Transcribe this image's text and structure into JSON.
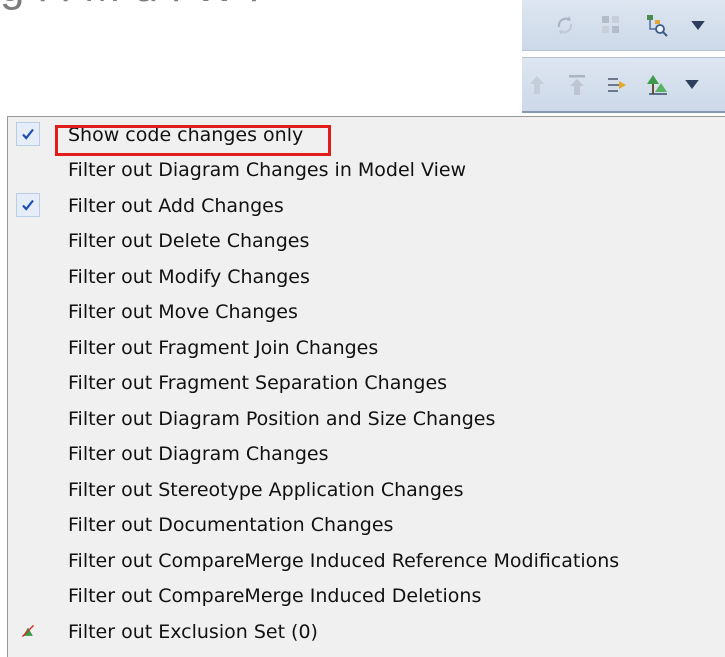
{
  "page": {
    "heading_text": "g   l   l    M   d   l  W   l"
  },
  "toolbar": {
    "top_row": [
      {
        "icon": "sync-arrows-icon"
      },
      {
        "icon": "grid-layout-icon"
      },
      {
        "icon": "tree-search-icon"
      },
      {
        "icon": "dropdown-arrow-icon"
      }
    ],
    "bottom_row": [
      {
        "icon": "up-arrow-icon"
      },
      {
        "icon": "up-top-arrow-icon"
      },
      {
        "icon": "merge-right-icon"
      },
      {
        "icon": "tree-filter-icon"
      },
      {
        "icon": "dropdown-arrow-icon"
      }
    ]
  },
  "menu": {
    "items": [
      {
        "label": "Show code changes only",
        "checked": true
      },
      {
        "label": "Filter out Diagram Changes in Model View",
        "checked": false
      },
      {
        "label": "Filter out Add Changes",
        "checked": true
      },
      {
        "label": "Filter out Delete Changes",
        "checked": false
      },
      {
        "label": "Filter out Modify Changes",
        "checked": false
      },
      {
        "label": "Filter out Move Changes",
        "checked": false
      },
      {
        "label": "Filter out Fragment Join Changes",
        "checked": false
      },
      {
        "label": "Filter out Fragment Separation Changes",
        "checked": false
      },
      {
        "label": "Filter out Diagram Position and Size Changes",
        "checked": false
      },
      {
        "label": "Filter out Diagram Changes",
        "checked": false
      },
      {
        "label": "Filter out Stereotype Application Changes",
        "checked": false
      },
      {
        "label": "Filter out Documentation Changes",
        "checked": false
      },
      {
        "label": "Filter out CompareMerge Induced Reference Modifications",
        "checked": false
      },
      {
        "label": "Filter out CompareMerge Induced Deletions",
        "checked": false
      },
      {
        "label": "Filter out Exclusion Set (0)",
        "checked": false,
        "icon": "exclusion-set-icon"
      }
    ]
  },
  "colors": {
    "check": "#1c4fb3",
    "highlight": "#e21b1b",
    "menu_bg": "#f0f0f0",
    "toolbar_bg": "#d6e0ed"
  }
}
